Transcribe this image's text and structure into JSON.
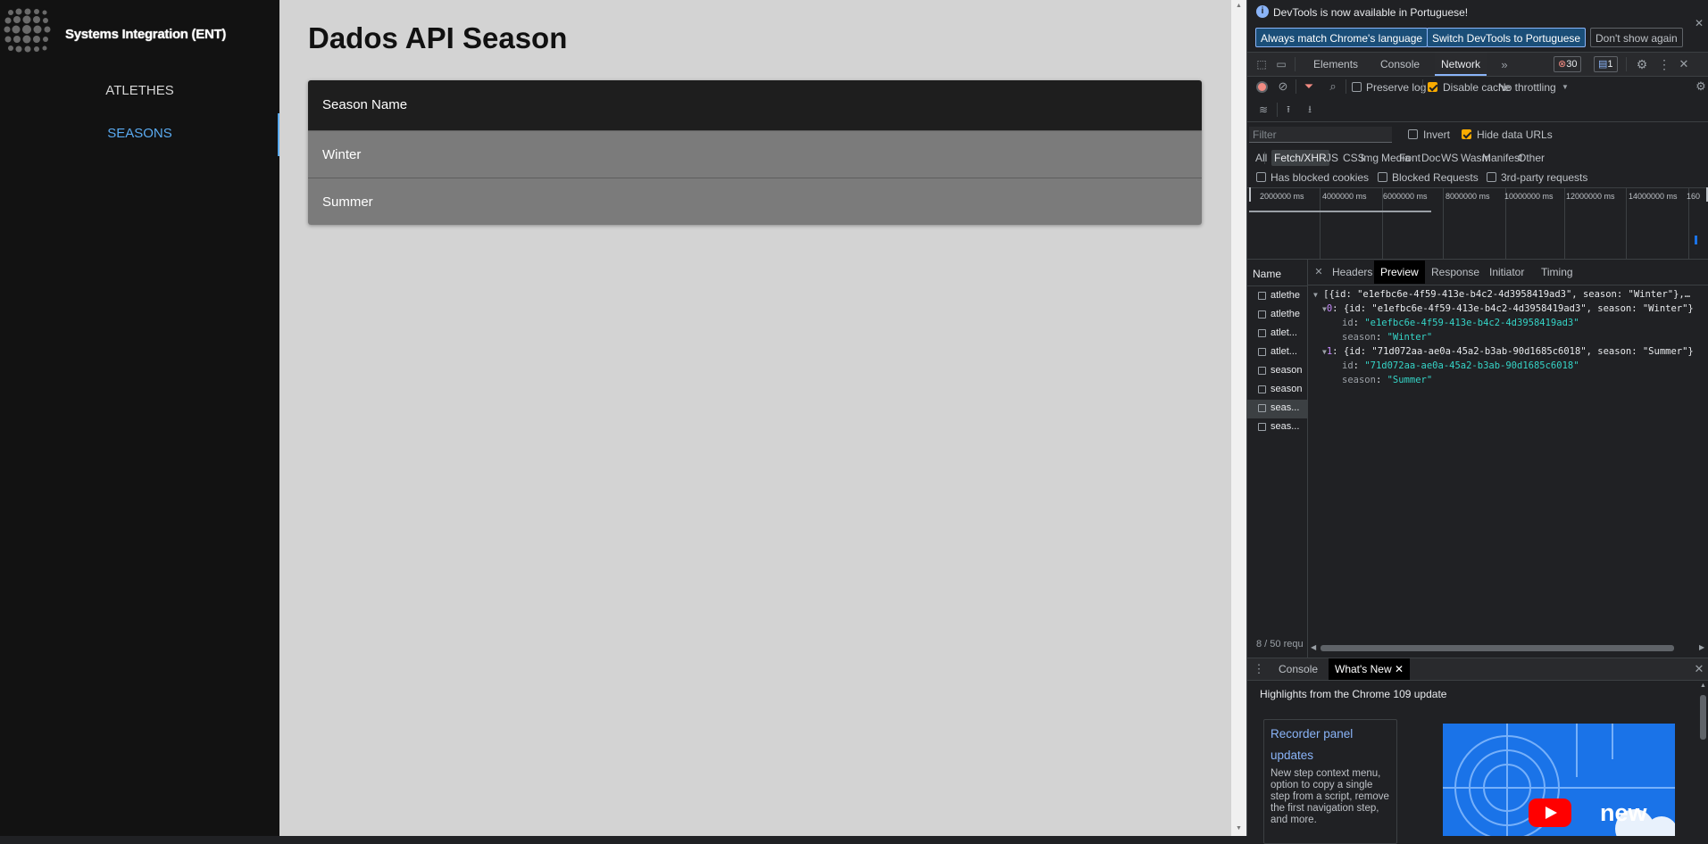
{
  "app": {
    "brand": "Systems Integration (ENT)",
    "nav": [
      {
        "label": "ATLETHES"
      },
      {
        "label": "SEASONS"
      }
    ],
    "page_title": "Dados API Season",
    "table": {
      "header": "Season Name",
      "rows": [
        {
          "value": "Winter"
        },
        {
          "value": "Summer"
        }
      ]
    }
  },
  "devtools": {
    "banner": {
      "text": "DevTools is now available in Portuguese!",
      "btn_match": "Always match Chrome's language",
      "btn_switch": "Switch DevTools to Portuguese",
      "btn_dismiss": "Don't show again"
    },
    "tabs": [
      "Elements",
      "Console",
      "Network"
    ],
    "error_count": "30",
    "message_count": "1",
    "toolbar": {
      "preserve_log": "Preserve log",
      "disable_cache": "Disable cache",
      "throttling": "No throttling"
    },
    "filter": {
      "placeholder": "Filter",
      "invert": "Invert",
      "hide_data_urls": "Hide data URLs"
    },
    "types": [
      "All",
      "Fetch/XHR",
      "JS",
      "CSS",
      "Img",
      "Media",
      "Font",
      "Doc",
      "WS",
      "Wasm",
      "Manifest",
      "Other"
    ],
    "blocked": {
      "has_blocked_cookies": "Has blocked cookies",
      "blocked_requests": "Blocked Requests",
      "third_party": "3rd-party requests"
    },
    "timeline_ticks": [
      "2000000 ms",
      "4000000 ms",
      "6000000 ms",
      "8000000 ms",
      "10000000 ms",
      "12000000 ms",
      "14000000 ms",
      "160"
    ],
    "name_header": "Name",
    "requests": [
      "atlethe",
      "atlethe",
      "atlet...",
      "atlet...",
      "season",
      "season",
      "seas...",
      "seas..."
    ],
    "request_status": "8 / 50 requ",
    "detail_tabs": [
      "Headers",
      "Preview",
      "Response",
      "Initiator",
      "Timing"
    ],
    "preview": {
      "summary": "[{id: \"e1efbc6e-4f59-413e-b4c2-4d3958419ad3\", season: \"Winter\"},…",
      "item0_summary": "{id: \"e1efbc6e-4f59-413e-b4c2-4d3958419ad3\", season: \"Winter\"}",
      "item0_id": "\"e1efbc6e-4f59-413e-b4c2-4d3958419ad3\"",
      "item0_season": "\"Winter\"",
      "item1_summary": "{id: \"71d072aa-ae0a-45a2-b3ab-90d1685c6018\", season: \"Summer\"}",
      "item1_id": "\"71d072aa-ae0a-45a2-b3ab-90d1685c6018\"",
      "item1_season": "\"Summer\"",
      "idx0": "0",
      "idx1": "1",
      "key_id": "id",
      "key_season": "season"
    },
    "drawer": {
      "tabs": [
        "Console",
        "What's New"
      ],
      "headline": "Highlights from the Chrome 109 update",
      "card_title": "Recorder panel updates",
      "card_body": "New step context menu, option to copy a single step from a script, remove the first navigation step, and more.",
      "video_text": "new"
    },
    "colors": {
      "accent": "#8ab4f8",
      "nav_active": "#5aaaf0",
      "record": "#f28b82",
      "checkbox": "#f9ab00"
    }
  }
}
